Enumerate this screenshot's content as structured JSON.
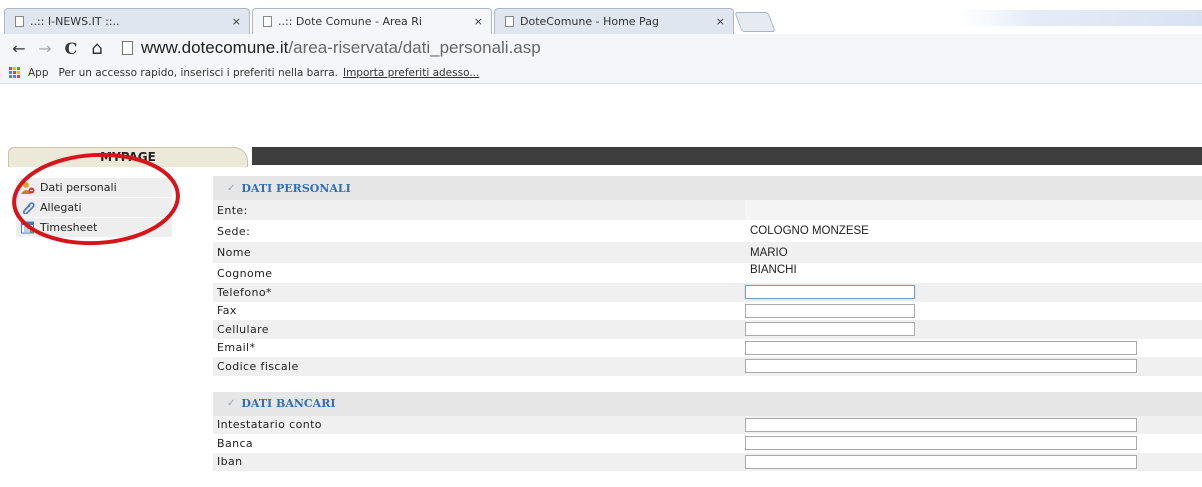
{
  "browser": {
    "tabs": [
      {
        "title": "..:: I-NEWS.IT ::..",
        "active": false
      },
      {
        "title": "..:: Dote Comune - Area Ri",
        "active": true
      },
      {
        "title": "DoteComune - Home Pag",
        "active": false
      }
    ],
    "close_glyph": "×",
    "nav": {
      "back": "←",
      "forward": "→",
      "reload": "C",
      "home": "⌂"
    },
    "url_host": "www.dotecomune.it",
    "url_path": "/area-riservata/dati_personali.asp",
    "bookmarks": {
      "apps_label": "App",
      "hint": "Per un accesso rapido, inserisci i preferiti nella barra.",
      "import_link": "Importa preferiti adesso..."
    }
  },
  "header": {
    "tab_label": "MYPAGE"
  },
  "menu": {
    "items": [
      {
        "label": "Dati personali",
        "icon": "user-icon"
      },
      {
        "label": "Allegati",
        "icon": "paperclip-icon"
      },
      {
        "label": "Timesheet",
        "icon": "timesheet-icon"
      }
    ]
  },
  "form": {
    "section_personal": "DATI PERSONALI",
    "personal": [
      {
        "label": "Ente:",
        "value": ""
      },
      {
        "label": "Sede:",
        "value": "COLOGNO MONZESE"
      },
      {
        "label": "Nome",
        "value": "MARIO"
      },
      {
        "label": "Cognome",
        "value": "BIANCHI"
      },
      {
        "label": "Telefono*",
        "input": ""
      },
      {
        "label": "Fax",
        "input": ""
      },
      {
        "label": "Cellulare",
        "input": ""
      },
      {
        "label": "Email*",
        "input": ""
      },
      {
        "label": "Codice fiscale",
        "input": ""
      }
    ],
    "section_bank": "DATI BANCARI",
    "bank": [
      {
        "label": "Intestatario conto",
        "input": ""
      },
      {
        "label": "Banca",
        "input": ""
      },
      {
        "label": "Iban",
        "input": ""
      }
    ]
  },
  "colors": {
    "annotation": "#d8141b",
    "section_text": "#2f6fb7",
    "header_bar": "#3e3e3e"
  }
}
